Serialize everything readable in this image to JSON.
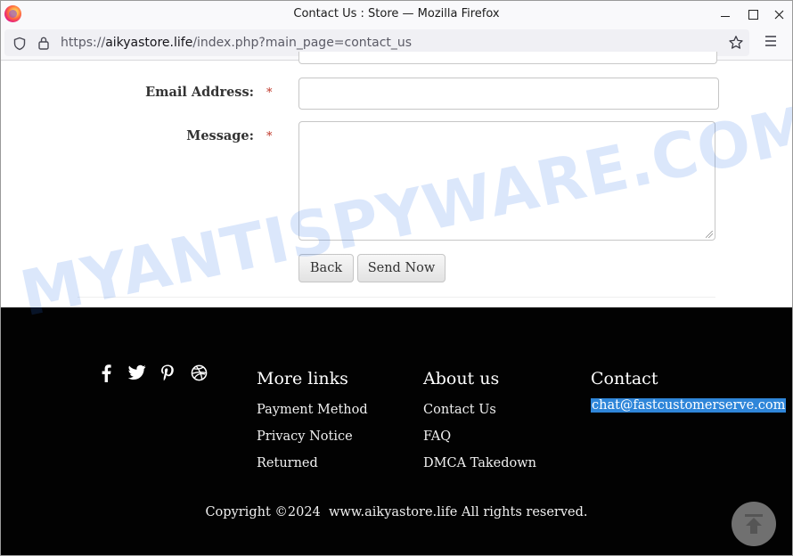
{
  "window": {
    "title": "Contact Us : Store — Mozilla Firefox"
  },
  "navbar": {
    "url_prefix": "https://",
    "url_host": "aikyastore.life",
    "url_path": "/index.php?main_page=contact_us"
  },
  "form": {
    "email_label": "Email Address:",
    "message_label": "Message:",
    "required_mark": "*",
    "email_value": "",
    "message_value": "",
    "back_label": "Back",
    "send_label": "Send Now"
  },
  "footer": {
    "social_icons": [
      "facebook-icon",
      "twitter-icon",
      "pinterest-icon",
      "dribbble-icon"
    ],
    "more_links": {
      "title": "More links",
      "items": [
        "Payment Method",
        "Privacy Notice",
        "Returned"
      ]
    },
    "about_us": {
      "title": "About us",
      "items": [
        "Contact Us",
        "FAQ",
        "DMCA Takedown"
      ]
    },
    "contact": {
      "title": "Contact",
      "email": "chat@fastcustomerserve.com"
    },
    "copyright": "Copyright ©2024  www.aikyastore.life All rights reserved."
  },
  "watermark": "MYANTISPYWARE.COM",
  "colors": {
    "footer_bg": "#020202",
    "email_highlight": "#2f86d9",
    "required": "#c0392b"
  }
}
